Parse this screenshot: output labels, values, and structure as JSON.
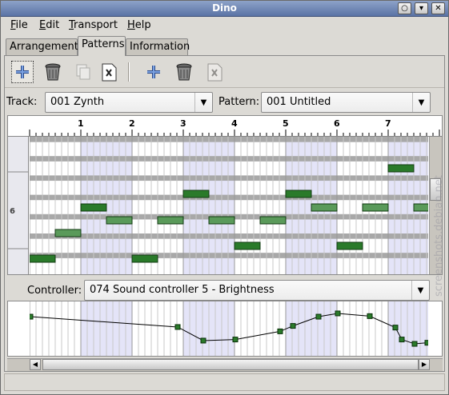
{
  "window": {
    "title": "Dino",
    "controls": [
      "circle-icon",
      "minimize-icon",
      "close-icon"
    ]
  },
  "menubar": {
    "items": [
      {
        "label": "File",
        "mnemonic": "F"
      },
      {
        "label": "Edit",
        "mnemonic": "E"
      },
      {
        "label": "Transport",
        "mnemonic": "T"
      },
      {
        "label": "Help",
        "mnemonic": "H"
      }
    ]
  },
  "tabs": [
    {
      "label": "Arrangement",
      "active": false
    },
    {
      "label": "Patterns",
      "active": true
    },
    {
      "label": "Information",
      "active": false
    }
  ],
  "toolbar": {
    "buttons": [
      {
        "name": "add-track-button",
        "icon": "plus-icon",
        "enabled": true
      },
      {
        "name": "delete-track-button",
        "icon": "trash-icon",
        "enabled": true
      },
      {
        "name": "duplicate-track-button",
        "icon": "copy-icon",
        "enabled": false
      },
      {
        "name": "track-properties-button",
        "icon": "properties-icon",
        "enabled": true
      },
      {
        "name": "add-pattern-button",
        "icon": "plus-icon",
        "enabled": true
      },
      {
        "name": "delete-pattern-button",
        "icon": "trash-icon",
        "enabled": true
      },
      {
        "name": "pattern-properties-button",
        "icon": "properties-icon",
        "enabled": false
      }
    ]
  },
  "selectors": {
    "track_label": "Track:",
    "track_value": "001 Zynth",
    "pattern_label": "Pattern:",
    "pattern_value": "001 Untitled"
  },
  "ruler": {
    "beats": [
      "1",
      "2",
      "3",
      "4",
      "5",
      "6",
      "7"
    ]
  },
  "keys": {
    "octave_label": "6"
  },
  "notes": [
    {
      "row": 0,
      "start": 14,
      "length": 2
    },
    {
      "row": 2,
      "start": 6,
      "length": 2
    },
    {
      "row": 2,
      "start": 10,
      "length": 2
    },
    {
      "row": 3,
      "start": 2,
      "length": 2
    },
    {
      "row": 3,
      "start": 11,
      "length": 2
    },
    {
      "row": 3,
      "start": 13,
      "length": 2
    },
    {
      "row": 3,
      "start": 15,
      "length": 2
    },
    {
      "row": 4,
      "start": 3,
      "length": 2
    },
    {
      "row": 4,
      "start": 5,
      "length": 2
    },
    {
      "row": 4,
      "start": 7,
      "length": 2
    },
    {
      "row": 4,
      "start": 9,
      "length": 2
    },
    {
      "row": 5,
      "start": 1,
      "length": 2
    },
    {
      "row": 6,
      "start": 8,
      "length": 2
    },
    {
      "row": 6,
      "start": 12,
      "length": 2
    },
    {
      "row": 7,
      "start": 0,
      "length": 2
    },
    {
      "row": 7,
      "start": 4,
      "length": 2
    }
  ],
  "controller": {
    "label": "Controller:",
    "value": "074 Sound controller 5 - Brightness",
    "points": [
      {
        "step": 0,
        "value": 0.72
      },
      {
        "step": 23,
        "value": 0.53
      },
      {
        "step": 27,
        "value": 0.28
      },
      {
        "step": 32,
        "value": 0.3
      },
      {
        "step": 39,
        "value": 0.45
      },
      {
        "step": 41,
        "value": 0.55
      },
      {
        "step": 45,
        "value": 0.72
      },
      {
        "step": 48,
        "value": 0.78
      },
      {
        "step": 53,
        "value": 0.73
      },
      {
        "step": 57,
        "value": 0.52
      },
      {
        "step": 58,
        "value": 0.3
      },
      {
        "step": 60,
        "value": 0.22
      },
      {
        "step": 62,
        "value": 0.24
      }
    ]
  },
  "watermark": "screenshots.debian.net",
  "colors": {
    "note_fill": "#2a7a2a",
    "note_light": "#5a9a5a",
    "beat_shade": "#e4e4f8",
    "black_key_row": "#a8a8a8"
  }
}
